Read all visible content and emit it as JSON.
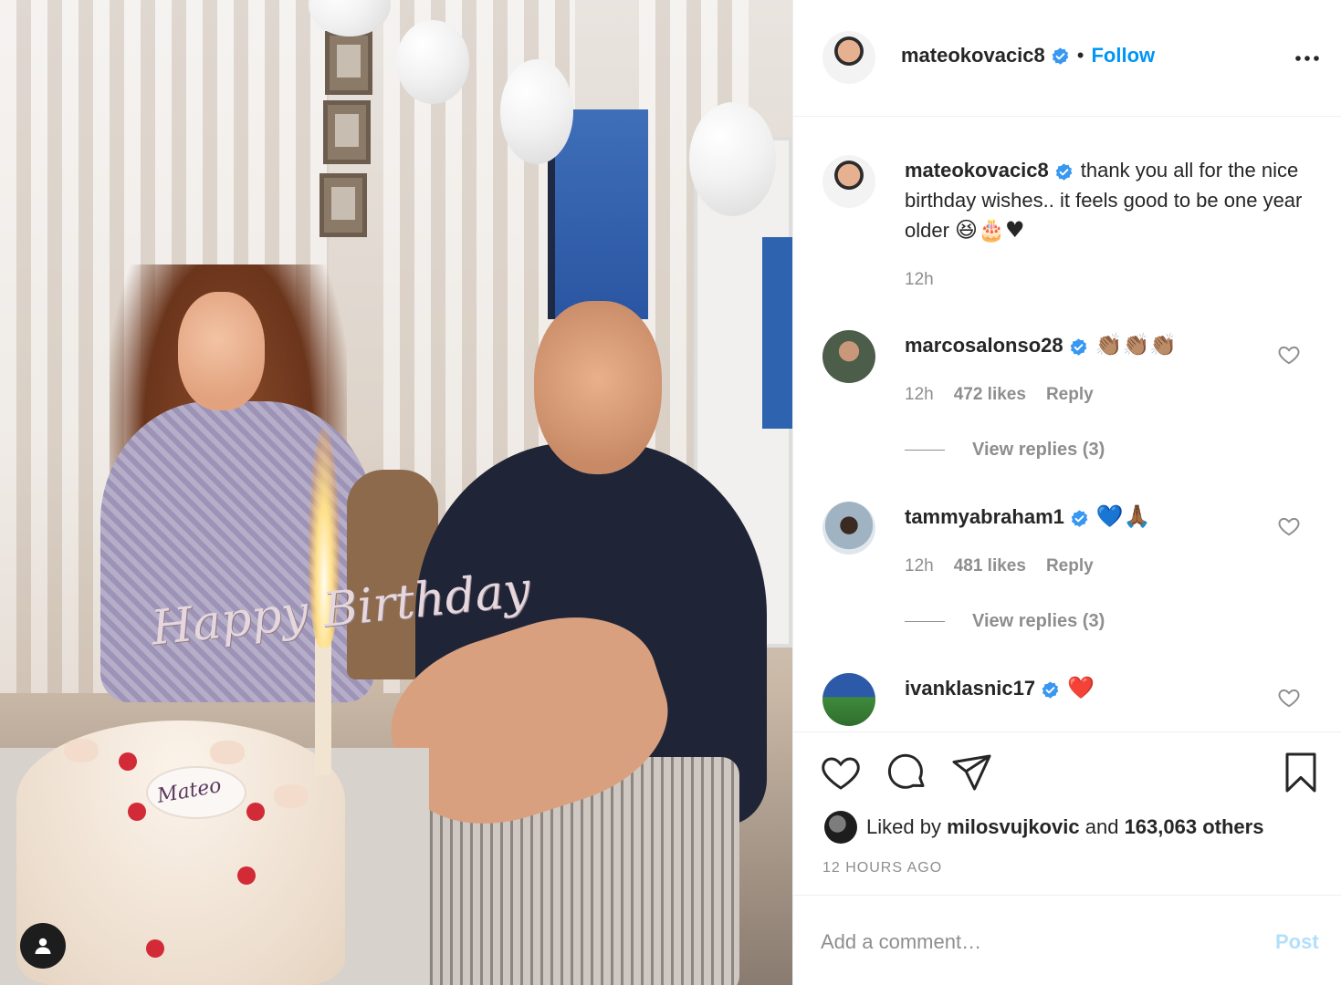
{
  "post": {
    "author": "mateokovacic8",
    "follow_label": "Follow",
    "separator": "•",
    "caption": "thank you all for the nice birthday wishes.. it feels good to be one year older",
    "caption_emojis": "😆🎂♥",
    "caption_time": "12h",
    "photo": {
      "cake_topper": "Happy Birthday",
      "cake_plaque": "Mateo"
    }
  },
  "comments": [
    {
      "username": "marcosalonso28",
      "text": "👏🏽👏🏽👏🏽",
      "time": "12h",
      "likes": "472 likes",
      "reply_label": "Reply",
      "view_replies": "View replies (3)"
    },
    {
      "username": "tammyabraham1",
      "text": "💙🙏🏾",
      "time": "12h",
      "likes": "481 likes",
      "reply_label": "Reply",
      "view_replies": "View replies (3)"
    },
    {
      "username": "ivanklasnic17",
      "text": "❤️"
    }
  ],
  "likes": {
    "prefix": "Liked by",
    "user": "milosvujkovic",
    "conj": "and",
    "others": "163,063 others"
  },
  "timestamp": "12 HOURS AGO",
  "add_comment": {
    "placeholder": "Add a comment…",
    "post_label": "Post"
  },
  "icons": {
    "more": "more-options-icon",
    "like": "heart-icon",
    "comment": "comment-icon",
    "share": "share-icon",
    "save": "bookmark-icon",
    "verified": "verified-badge-icon",
    "tag": "user-tag-icon"
  },
  "colors": {
    "link_blue": "#0095f6",
    "verified_blue": "#3897f0",
    "muted": "#8e8e8e",
    "post_disabled": "#b2dffc"
  }
}
